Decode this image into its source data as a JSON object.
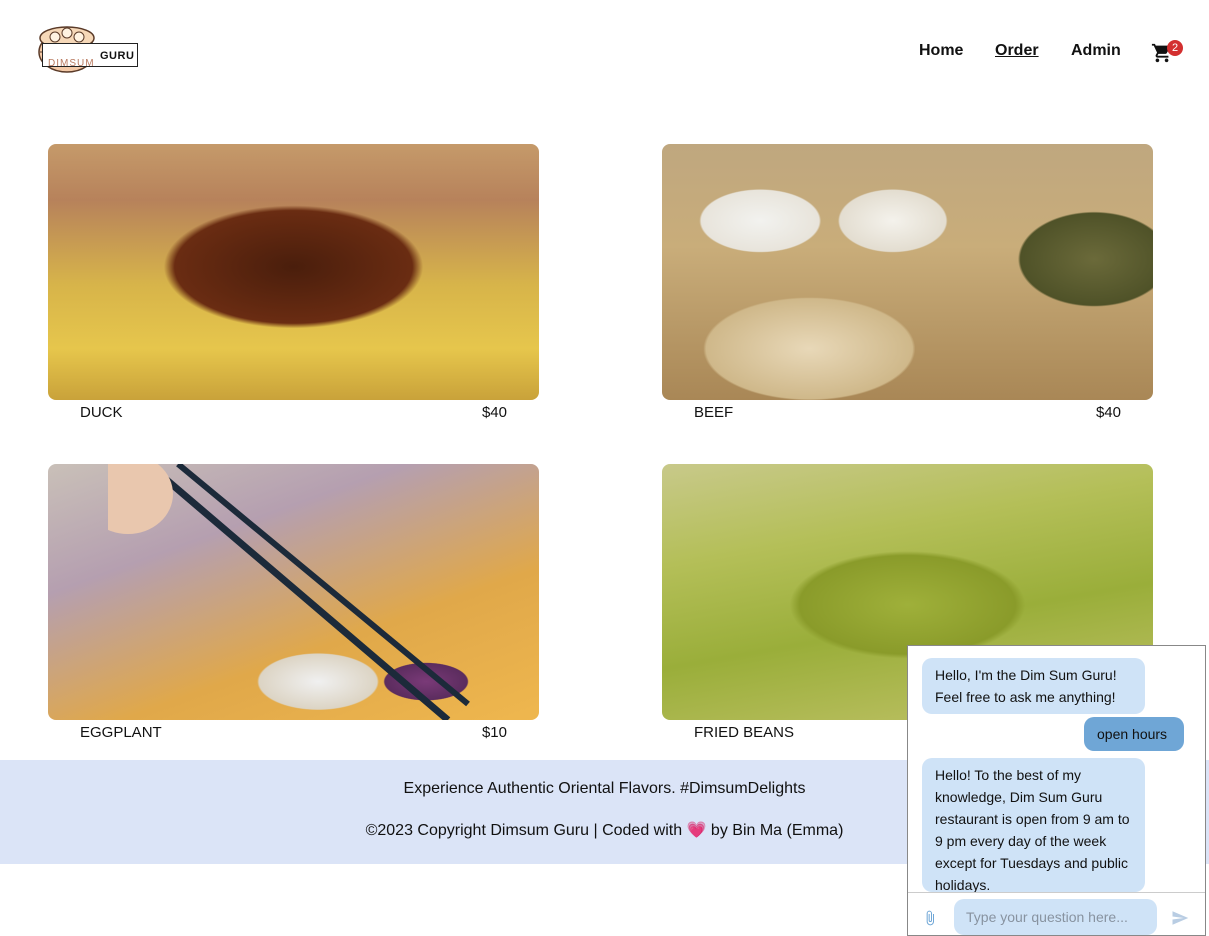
{
  "header": {
    "logo_word": "GURU",
    "logo_word_faded": "DIMSUM",
    "nav": {
      "home": "Home",
      "order": "Order",
      "admin": "Admin"
    },
    "cart_count": "2",
    "icons": {
      "cart": "shopping-cart-icon",
      "logo": "dimsum-steamer-logo"
    }
  },
  "products": [
    {
      "name": "DUCK",
      "price": "$40"
    },
    {
      "name": "BEEF",
      "price": "$40"
    },
    {
      "name": "EGGPLANT",
      "price": "$10"
    },
    {
      "name": "FRIED BEANS",
      "price": ""
    }
  ],
  "footer": {
    "tagline": "Experience Authentic Oriental Flavors. #DimsumDelights",
    "copyright": "©2023 Copyright Dimsum Guru | Coded with 💗 by Bin Ma (Emma)"
  },
  "chat": {
    "messages": [
      {
        "from": "bot",
        "text": "Hello, I'm the Dim Sum Guru! Feel free to ask me anything!"
      },
      {
        "from": "user",
        "text": "open hours"
      },
      {
        "from": "bot",
        "text": "Hello! To the best of my knowledge, Dim Sum Guru restaurant is open from 9 am to 9 pm every day of the week except for Tuesdays and public holidays."
      }
    ],
    "input_placeholder": "Type your question here...",
    "icons": {
      "attach": "paperclip-icon",
      "send": "send-icon"
    }
  },
  "colors": {
    "footer_bg": "#dbe4f7",
    "bot_bubble": "#cfe3f7",
    "user_bubble": "#6fa6d6",
    "cart_badge": "#d32f2f"
  }
}
